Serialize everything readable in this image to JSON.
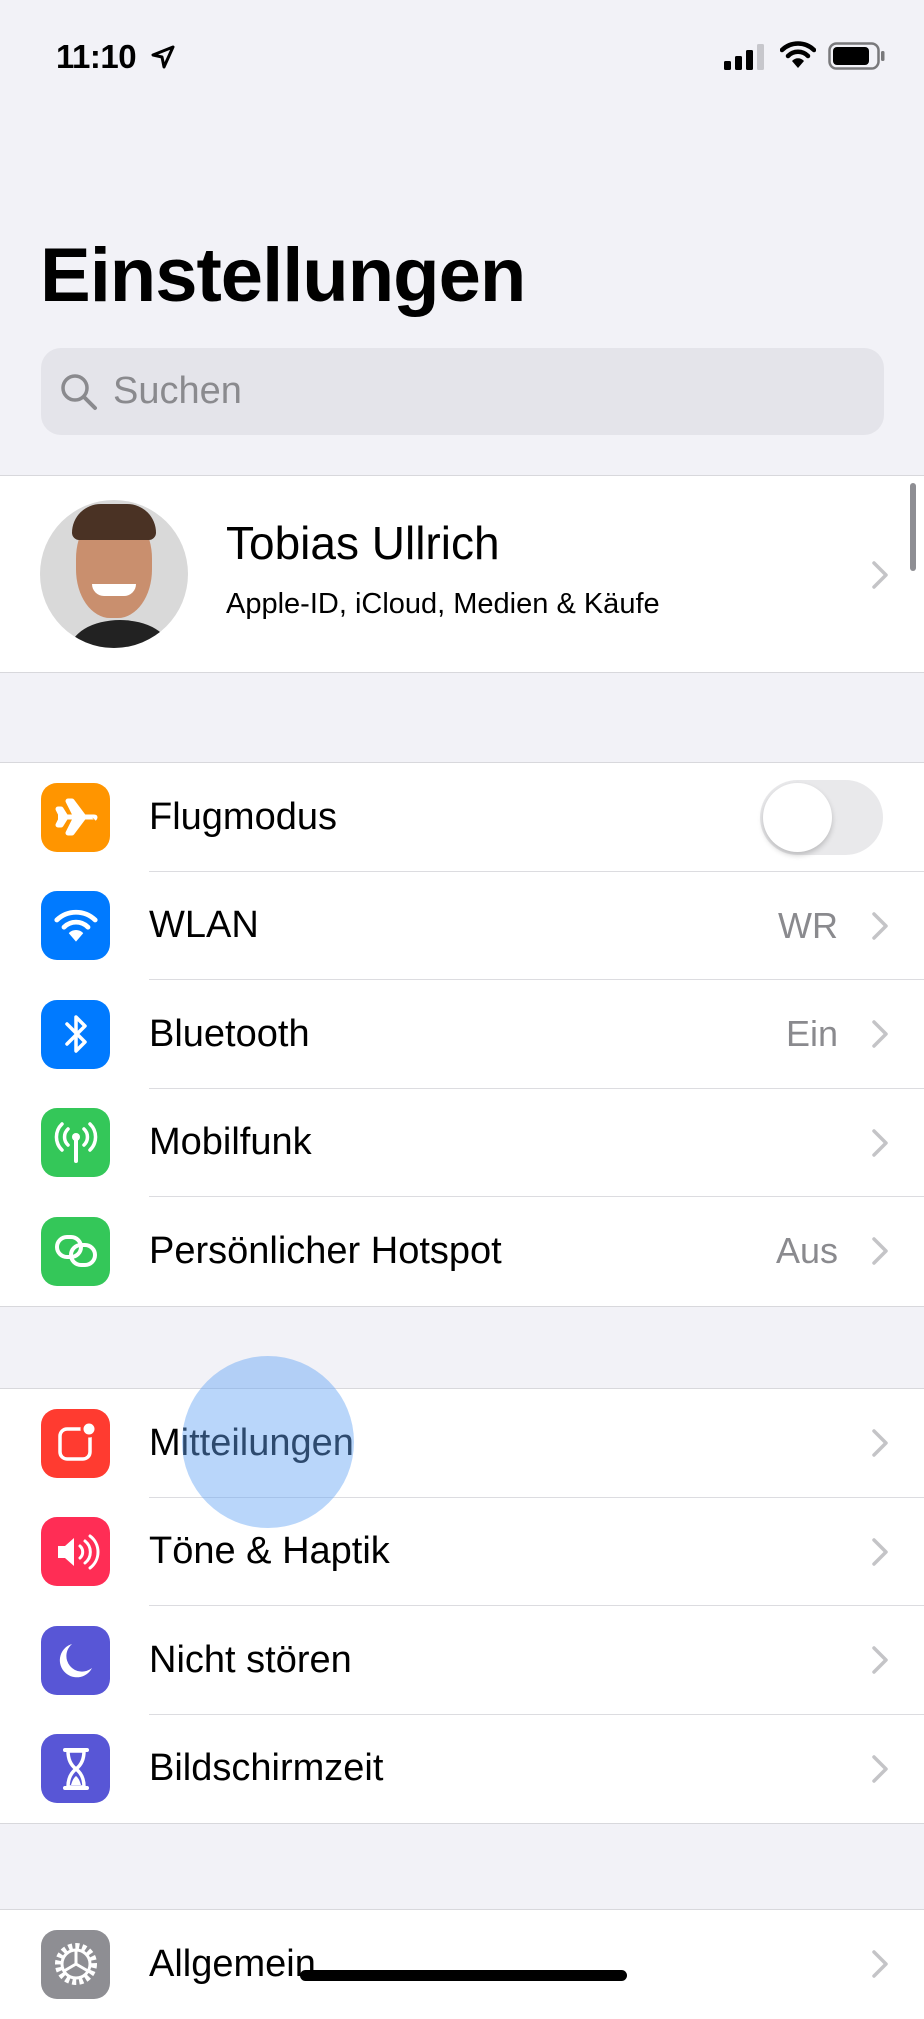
{
  "status_bar": {
    "time": "11:10"
  },
  "header": {
    "title": "Einstellungen"
  },
  "search": {
    "placeholder": "Suchen"
  },
  "profile": {
    "name": "Tobias Ullrich",
    "subtitle": "Apple-ID, iCloud, Medien & Käufe"
  },
  "groups": [
    {
      "items": [
        {
          "label": "Flugmodus",
          "icon": "airplane-icon",
          "color": "#ff9500",
          "toggle": false
        },
        {
          "label": "WLAN",
          "icon": "wifi-icon",
          "color": "#007aff",
          "value": "WR"
        },
        {
          "label": "Bluetooth",
          "icon": "bluetooth-icon",
          "color": "#007aff",
          "value": "Ein"
        },
        {
          "label": "Mobilfunk",
          "icon": "antenna-icon",
          "color": "#34c759"
        },
        {
          "label": "Persönlicher Hotspot",
          "icon": "hotspot-icon",
          "color": "#34c759",
          "value": "Aus"
        }
      ]
    },
    {
      "items": [
        {
          "label": "Mitteilungen",
          "icon": "notifications-icon",
          "color": "#ff3b30"
        },
        {
          "label": "Töne & Haptik",
          "icon": "speaker-icon",
          "color": "#ff2d55"
        },
        {
          "label": "Nicht stören",
          "icon": "moon-icon",
          "color": "#5856d6"
        },
        {
          "label": "Bildschirmzeit",
          "icon": "hourglass-icon",
          "color": "#5856d6"
        }
      ]
    },
    {
      "items": [
        {
          "label": "Allgemein",
          "icon": "gear-icon",
          "color": "#8e8e93"
        }
      ]
    }
  ]
}
